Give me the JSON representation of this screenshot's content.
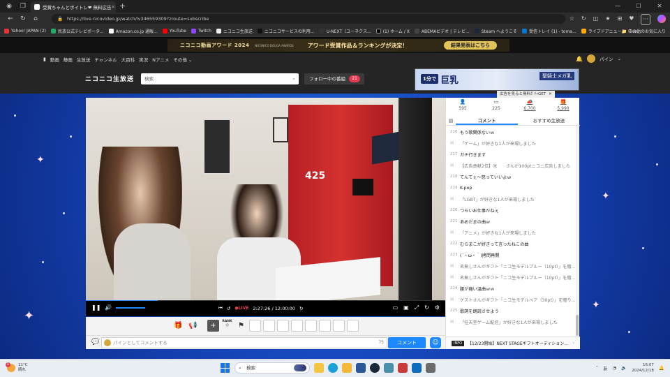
{
  "browser": {
    "tab_title": "受賞ちゃんとボイトレ❤ 無料広告",
    "url": "https://live.nicovideo.jp/watch/lv346559309?zroute=subscribe",
    "bookmarks": [
      "Yahoo! JAPAN (2)",
      "民放公式テレビポータ...",
      "Amazon.co.jp 通販...",
      "YouTube",
      "Twitch",
      "ニコニコ生放送",
      "ニコニコサービスの利用...",
      "U-NEXT（ユーネクス...",
      "(1) ホーム / X",
      "ABEMAビデオ | テレビ...",
      "Steam へようこそ",
      "受信トレイ (1) - toma...",
      "ライブドアニュース（live..."
    ],
    "bookmark_folder": "その他のお気に入り"
  },
  "colors": {
    "accent": "#1e88ff",
    "badge_red": "#e53950",
    "door_red": "#d5322f"
  },
  "site": {
    "award": {
      "title": "ニコニコ動画アワード 2024",
      "subtitle": "NICONICO DOUGA AWARDS",
      "message": "アワード受賞作品＆ランキングが決定！",
      "button": "結果発表はこちら"
    },
    "nav": [
      "動画",
      "静画",
      "生放送",
      "チャンネル",
      "大百科",
      "実況",
      "Nアニメ",
      "その他"
    ],
    "user_name": "パイン",
    "logo": "ニコニコ生放送",
    "search_placeholder": "検索",
    "follow_label": "フォロー中の番組",
    "follow_count": "21",
    "ad": {
      "tag": "1分で",
      "headline": "巨乳",
      "brand": "聖騎士メガ乳",
      "note": "広告を見ると無料ｶﾞﾁｬGET"
    }
  },
  "player": {
    "door_number": "425",
    "live_label": "●LIVE",
    "time": "2:27:26 / 12:00:00",
    "rank_label": "RANK",
    "progress": 0.2
  },
  "comment_bar": {
    "placeholder": "パインとしてコメントする",
    "char_count": "75",
    "send": "コメント"
  },
  "side": {
    "stats": [
      "595",
      "225",
      "6,700",
      "5,990"
    ],
    "tabs": [
      "コメント",
      "おすすめ生放送"
    ],
    "comments": [
      {
        "n": "216",
        "t": "もう歌関係ないｗ"
      },
      {
        "n": "",
        "t": "「ゲーム」が好きな1人が来場しました"
      },
      {
        "n": "217",
        "t": "ガチ行きます"
      },
      {
        "n": "",
        "t": "【広告貢献2位】氷　　さんが100ptニコニ広告しました"
      },
      {
        "n": "218",
        "t": "てんてぇ～怒っていいよｗ"
      },
      {
        "n": "219",
        "t": "K-pop"
      },
      {
        "n": "",
        "t": "「LGBT」が好きな1人が来場しました"
      },
      {
        "n": "220",
        "t": "つらいお仕事だねぇ"
      },
      {
        "n": "221",
        "t": "あめだまの曲ｗ"
      },
      {
        "n": "",
        "t": "「アニメ」が好きな1人が来場しました"
      },
      {
        "n": "222",
        "t": "むらまこが好きって言ったねこの曲"
      },
      {
        "n": "223",
        "t": "(´・ω・｀)拷問再開"
      },
      {
        "n": "",
        "t": "名無しさんがギフト「ニコ生モデルブルー（10pt）」を贈りました"
      },
      {
        "n": "",
        "t": "名無しさんがギフト「ニコ生モデルブルー（10pt）」を贈りました"
      },
      {
        "n": "224",
        "t": "腰が痛い温曲ｗｗ"
      },
      {
        "n": "",
        "t": "ゲストさんがギフト「ニコ生モデルベア（30pt）」を贈りました"
      },
      {
        "n": "225",
        "t": "歌詞を朗読させよう"
      },
      {
        "n": "",
        "t": "「任天堂ゲーム配信」が好きな1人が来場しました"
      }
    ],
    "info_badge": "INFO",
    "info_text": "【12/23開始】NEXT STAGEギフトオーディション..."
  },
  "taskbar": {
    "temp": "11°C",
    "weather": "晴れ",
    "weather_badge": "1",
    "search": "検索",
    "ime": "あ",
    "time": "16:07",
    "date": "2024/12/18"
  }
}
